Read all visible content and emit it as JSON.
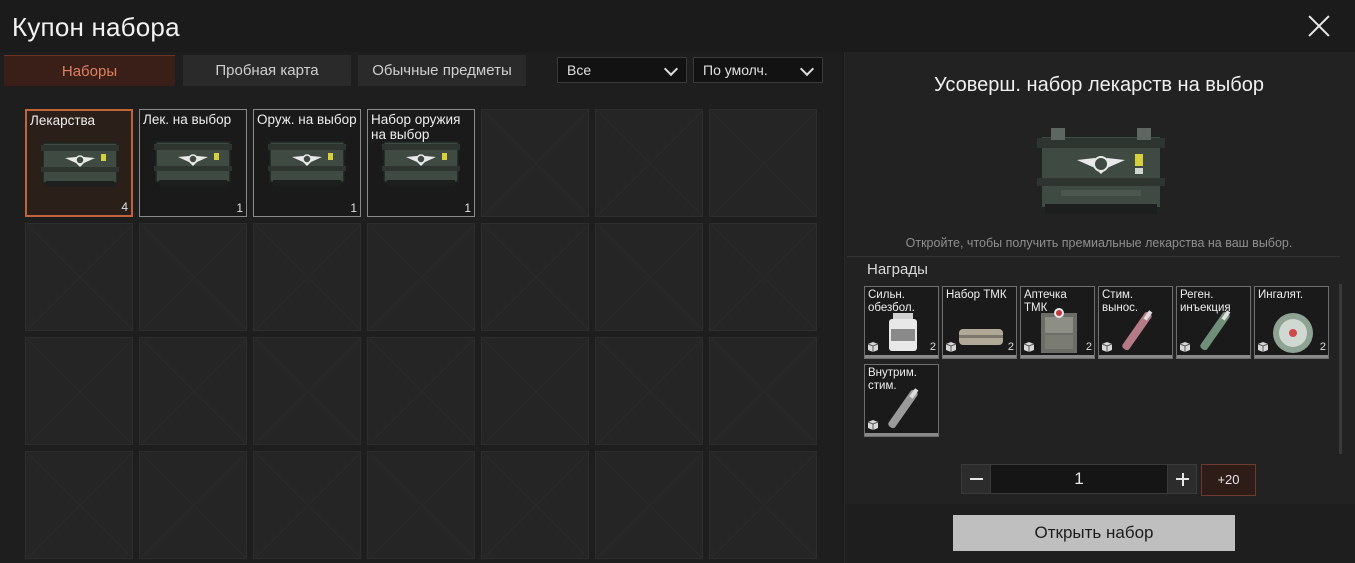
{
  "window": {
    "title": "Купон набора"
  },
  "tabs": [
    {
      "label": "Наборы",
      "active": true
    },
    {
      "label": "Пробная карта",
      "active": false
    },
    {
      "label": "Обычные предметы",
      "active": false
    }
  ],
  "filters": {
    "category": "Все",
    "sort": "По умолч."
  },
  "grid": {
    "items": [
      {
        "label": "Лекарства",
        "count": "4",
        "selected": true
      },
      {
        "label": "Лек. на выбор",
        "count": "1",
        "selected": false
      },
      {
        "label": "Оруж. на выбор",
        "count": "1",
        "selected": false
      },
      {
        "label": "Набор оружия на выбор",
        "count": "1",
        "selected": false
      }
    ]
  },
  "detail": {
    "title": "Усоверш. набор лекарств на выбор",
    "description": "Откройте, чтобы получить премиальные лекарства на ваш выбор.",
    "rewards_label": "Награды",
    "rewards": [
      {
        "label": "Сильн. обезбол.",
        "count": "2",
        "icon": "pill-bottle-icon"
      },
      {
        "label": "Набор ТМК",
        "count": "2",
        "icon": "pouch-icon"
      },
      {
        "label": "Аптечка ТМК",
        "count": "2",
        "icon": "medkit-icon"
      },
      {
        "label": "Стим. вынос.",
        "count": "",
        "icon": "syringe-icon"
      },
      {
        "label": "Реген. инъекция",
        "count": "",
        "icon": "injector-icon"
      },
      {
        "label": "Ингалят.",
        "count": "2",
        "icon": "inhaler-icon"
      },
      {
        "label": "Внутрим. стим.",
        "count": "",
        "icon": "autoinjector-icon"
      }
    ],
    "quantity": "1",
    "plus20_label": "+20",
    "open_button": "Открыть набор"
  },
  "colors": {
    "accent": "#c0643e",
    "tab_active_text": "#e07f5f",
    "open_button_bg": "#bfbfbf"
  }
}
